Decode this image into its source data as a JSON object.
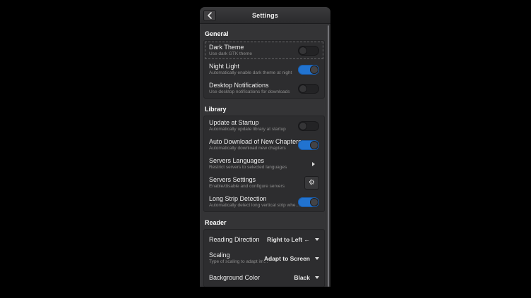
{
  "window": {
    "title": "Settings",
    "back_button": "back"
  },
  "colors": {
    "page_background": "#000000",
    "dialog_background": "#343436",
    "card_background": "#2d2d2f",
    "accent_switch_on": "#2173d0",
    "title_text": "#ededed",
    "subtitle_text": "#8d8d8d"
  },
  "sections": [
    {
      "label": "General",
      "rows": [
        {
          "title": "Dark Theme",
          "subtitle": "Use dark GTK theme",
          "control": "switch",
          "state": "off"
        },
        {
          "title": "Night Light",
          "subtitle": "Automatically enable dark theme at night",
          "control": "switch",
          "state": "on"
        },
        {
          "title": "Desktop Notifications",
          "subtitle": "Use desktop notifications for downloads",
          "control": "switch",
          "state": "off"
        }
      ]
    },
    {
      "label": "Library",
      "rows": [
        {
          "title": "Update at Startup",
          "subtitle": "Automatically update library at startup",
          "control": "switch",
          "state": "off"
        },
        {
          "title": "Auto Download of New Chapters",
          "subtitle": "Automatically download new chapters",
          "control": "switch",
          "state": "on"
        },
        {
          "title": "Servers Languages",
          "subtitle": "Restrict servers to selected languages",
          "control": "arrow"
        },
        {
          "title": "Servers Settings",
          "subtitle": "Enable/disable and configure servers",
          "control": "gear-button",
          "icon": "⚙"
        },
        {
          "title": "Long Strip Detection",
          "subtitle": "Automatically detect long vertical strip whe…",
          "control": "switch",
          "state": "on"
        }
      ]
    },
    {
      "label": "Reader",
      "rows": [
        {
          "title": "Reading Direction",
          "subtitle": "",
          "control": "dropdown",
          "value": "Right to Left ←"
        },
        {
          "title": "Scaling",
          "subtitle": "Type of scaling to adapt im…",
          "control": "dropdown",
          "value": "Adapt to Screen"
        },
        {
          "title": "Background Color",
          "subtitle": "",
          "control": "dropdown",
          "value": "Black"
        }
      ]
    }
  ]
}
